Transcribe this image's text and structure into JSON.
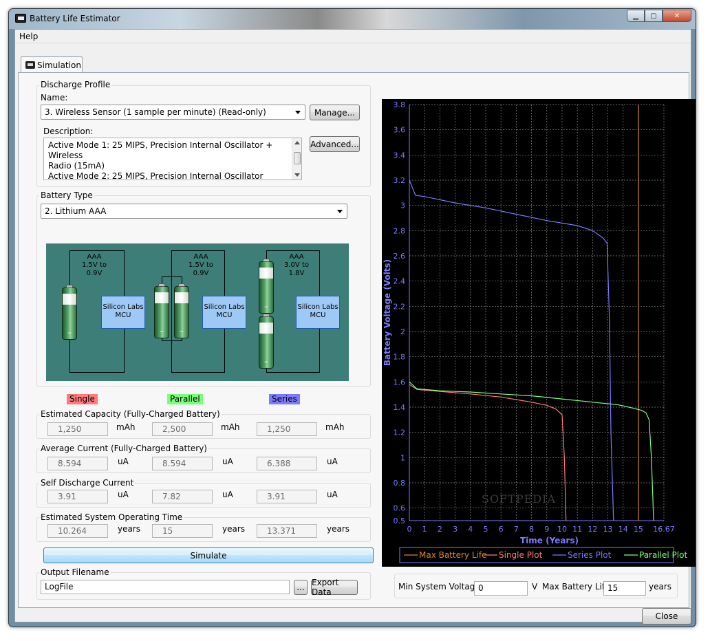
{
  "window": {
    "title": "Battery Life Estimator"
  },
  "menu": {
    "help": "Help"
  },
  "tab": {
    "label": "Simulation"
  },
  "discharge": {
    "group_title": "Discharge Profile",
    "name_label": "Name:",
    "name_value": "3. Wireless Sensor (1 sample per minute) (Read-only)",
    "manage_label": "Manage...",
    "description_label": "Description:",
    "description_line1": "Active Mode 1: 25 MIPS, Precision Internal Oscillator + Wireless",
    "description_line2": "Radio (15mA)",
    "description_line3": "Active Mode 2: 25 MIPS, Precision Internal Oscillator",
    "advanced_label": "Advanced..."
  },
  "battery": {
    "group_title": "Battery Type",
    "type_value": "2. Lithium AAA",
    "single_label": "AAA",
    "single_range1": "1.5V to",
    "single_range2": "0.9V",
    "parallel_label": "AAA",
    "parallel_range1": "1.5V to",
    "parallel_range2": "0.9V",
    "series_label": "AAA",
    "series_range1": "3.0V to",
    "series_range2": "1.8V",
    "mcu_line1": "Silicon Labs",
    "mcu_line2": "MCU",
    "single_legend": "Single",
    "parallel_legend": "Parallel",
    "series_legend": "Series",
    "colors": {
      "single": "#ff7a7a",
      "parallel": "#7aff7a",
      "series": "#7a7aff"
    }
  },
  "capacity": {
    "title": "Estimated Capacity (Fully-Charged Battery)",
    "single": "1,250",
    "parallel": "2,500",
    "series": "1,250",
    "unit": "mAh"
  },
  "current": {
    "title": "Average Current (Fully-Charged Battery)",
    "single": "8.594",
    "parallel": "8.594",
    "series": "6.388",
    "unit": "uA"
  },
  "self_discharge": {
    "title": "Self Discharge Current",
    "single": "3.91",
    "parallel": "7.82",
    "series": "3.91",
    "unit": "uA"
  },
  "operating_time": {
    "title": "Estimated System Operating Time",
    "single": "10.264",
    "parallel": "15",
    "series": "13.371",
    "unit": "years"
  },
  "simulate_label": "Simulate",
  "output": {
    "group_title": "Output Filename",
    "filename": "LogFile",
    "browse_label": "...",
    "export_label": "Export Data"
  },
  "settings": {
    "min_voltage_label": "Min System Voltage",
    "min_voltage_value": "0",
    "min_voltage_unit": "V",
    "max_life_label": "Max Battery Life",
    "max_life_value": "15",
    "max_life_unit": "years"
  },
  "close_label": "Close",
  "watermark": "SOFTPEDIA",
  "chart_data": {
    "type": "line",
    "xlabel": "Time (Years)",
    "ylabel": "Battery Voltage (Volts)",
    "xlim": [
      0,
      16.67
    ],
    "ylim": [
      0.5,
      3.8
    ],
    "xticks": [
      "0",
      "1",
      "2",
      "3",
      "4",
      "5",
      "6",
      "7",
      "8",
      "9",
      "10",
      "11",
      "12",
      "13",
      "14",
      "15",
      "16.67"
    ],
    "yticks": [
      "0.5",
      "0.6",
      "0.8",
      "1",
      "1.2",
      "1.4",
      "1.6",
      "1.8",
      "2",
      "2.2",
      "2.4",
      "2.6",
      "2.8",
      "3",
      "3.2",
      "3.4",
      "3.6",
      "3.8"
    ],
    "grid": true,
    "series": [
      {
        "name": "Max Battery Life",
        "color": "#e0861f",
        "x": [
          15,
          15
        ],
        "y": [
          0.5,
          3.8
        ]
      },
      {
        "name": "Single Plot",
        "color": "#ff7a7a",
        "x": [
          0,
          0.5,
          2,
          4,
          6,
          8,
          9,
          9.6,
          10.0,
          10.15,
          10.26
        ],
        "y": [
          1.58,
          1.54,
          1.525,
          1.505,
          1.48,
          1.44,
          1.415,
          1.385,
          1.34,
          1.0,
          0.5
        ]
      },
      {
        "name": "Series Plot",
        "color": "#7a7aff",
        "x": [
          0,
          0.4,
          1,
          3,
          5,
          7,
          9,
          11,
          12,
          12.7,
          12.95,
          13.1,
          13.2,
          13.37
        ],
        "y": [
          3.2,
          3.08,
          3.07,
          3.02,
          2.98,
          2.93,
          2.88,
          2.84,
          2.8,
          2.74,
          2.7,
          2.1,
          1.2,
          0.5
        ]
      },
      {
        "name": "Parallel Plot",
        "color": "#7aff7a",
        "x": [
          0,
          0.5,
          2,
          4,
          6,
          8,
          10,
          12,
          13.6,
          14.2,
          15.2,
          15.5,
          15.7,
          15.85,
          16.0
        ],
        "y": [
          1.6,
          1.545,
          1.53,
          1.52,
          1.505,
          1.49,
          1.465,
          1.44,
          1.42,
          1.405,
          1.375,
          1.355,
          1.3,
          1.0,
          0.5
        ]
      }
    ]
  }
}
